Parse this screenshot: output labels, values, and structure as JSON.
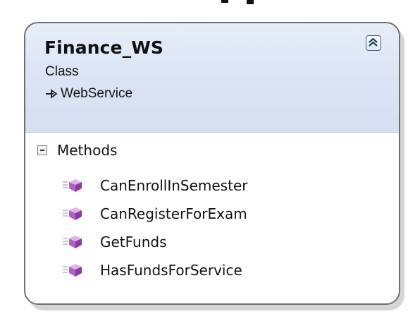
{
  "class": {
    "name": "Finance_WS",
    "kind": "Class",
    "base_class": "WebService"
  },
  "sections": [
    {
      "label": "Methods",
      "items": [
        {
          "name": "CanEnrollInSemester"
        },
        {
          "name": "CanRegisterForExam"
        },
        {
          "name": "GetFunds"
        },
        {
          "name": "HasFundsForService"
        }
      ]
    }
  ],
  "icons": {
    "collapse": "double-chevron-up-icon",
    "inheritance": "inheritance-arrow-icon",
    "section_toggle": "minus-box-icon",
    "method": "public-method-icon"
  },
  "colors": {
    "header_top": "#e7eef9",
    "header_bottom": "#d6dfef",
    "border": "#6f6f6f",
    "method_icon": "#b35fc9"
  }
}
